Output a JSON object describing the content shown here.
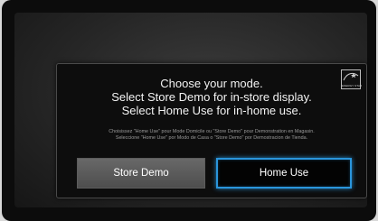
{
  "dialog": {
    "title": "Choose your mode.",
    "line_store": "Select Store Demo for in-store display.",
    "line_home": "Select Home Use for in-home use.",
    "fine_print_1": "Choisissez \"Home Use\" pour Mode Domicile ou \"Store Demo\" pour Demonstration en Magasin.",
    "fine_print_2": "Seleccione \"Home Use\" por Modo de Casa o \"Store Demo\" por Demostracion de Tienda.",
    "logo_text": "ENERGY STAR",
    "buttons": {
      "store_demo": "Store Demo",
      "home_use": "Home Use"
    },
    "selected": "home_use"
  },
  "colors": {
    "focus": "#2a95dc",
    "button_default": "#5a5a5a",
    "dialog_bg": "#0d0d0d"
  },
  "icons": [
    "energy-star-logo"
  ]
}
